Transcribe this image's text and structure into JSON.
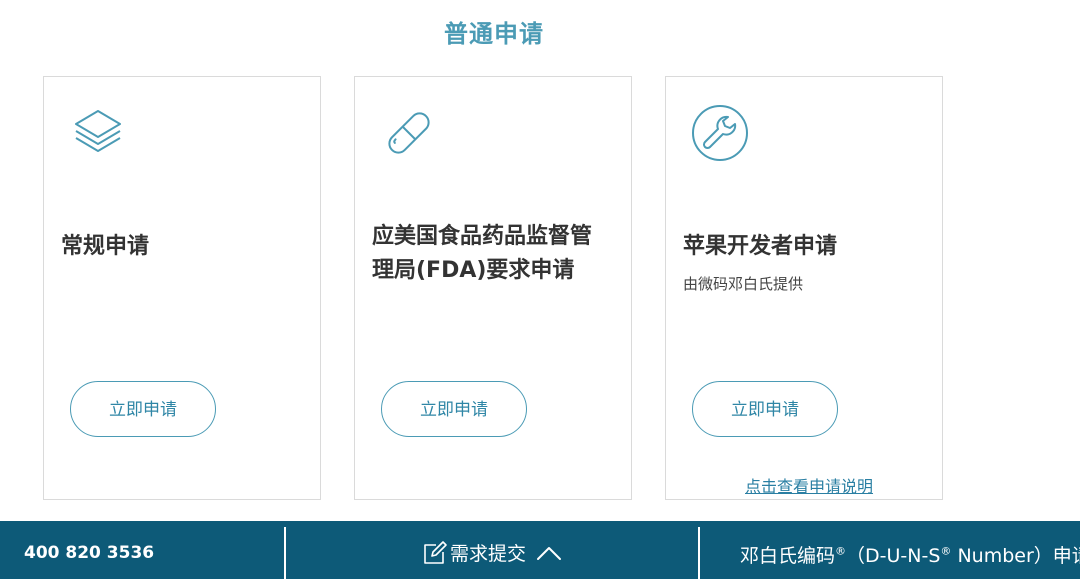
{
  "section": {
    "title": "普通申请"
  },
  "cards": [
    {
      "icon": "stack-layers-icon",
      "title": "常规申请",
      "button_label": "立即申请"
    },
    {
      "icon": "pill-capsule-icon",
      "title_line1": "应美国食品药品监督管",
      "title_line2": "理局(FDA)要求申请",
      "button_label": "立即申请"
    },
    {
      "icon": "wrench-icon",
      "title": "苹果开发者申请",
      "subtitle": "由微码邓白氏提供",
      "button_label": "立即申请",
      "link_label": "点击查看申请说明"
    }
  ],
  "footer": {
    "phone": "400 820 3536",
    "submit_label": "需求提交",
    "duns_part1": "邓白氏编码",
    "duns_sup1": "®",
    "duns_part2": "（D-U-N-S",
    "duns_sup2": "®",
    "duns_part3": " Number）申请"
  },
  "colors": {
    "accent": "#4b9bb5",
    "footer_bg": "#0d5a78",
    "card_border": "#dadada"
  }
}
